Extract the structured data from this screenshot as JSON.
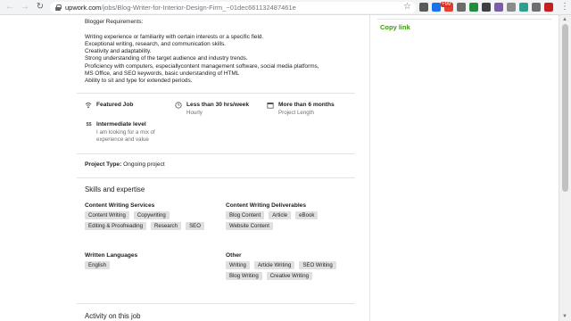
{
  "browser": {
    "back_glyph": "←",
    "forward_glyph": "→",
    "reload_glyph": "↻",
    "url_host": "upwork.com",
    "url_path": "/jobs/Blog-Writer-for-Interior-Design-Firm_~01dec661132487461e",
    "star_glyph": "☆",
    "extensions": [
      {
        "name": "extension-icon-dark",
        "color": "#5a5a5a"
      },
      {
        "name": "extension-icon-blue",
        "color": "#1a73e8"
      },
      {
        "name": "extension-icon-red",
        "color": "#e34133"
      },
      {
        "name": "extension-icon-gray",
        "color": "#6b6b6b"
      },
      {
        "name": "extension-icon-green",
        "color": "#1e8e3e"
      },
      {
        "name": "extension-icon-dark-2",
        "color": "#3c4043"
      },
      {
        "name": "extension-icon-purple",
        "color": "#7b5ea7"
      },
      {
        "name": "extension-icon-gray-2",
        "color": "#8a8a8a"
      },
      {
        "name": "extension-icon-teal",
        "color": "#2e9e8e"
      },
      {
        "name": "extension-icon-gray-3",
        "color": "#6f6f6f"
      },
      {
        "name": "extension-icon-red-2",
        "color": "#c5221f"
      }
    ],
    "badge_text": "+99",
    "menu_glyph": "⋮"
  },
  "requirements": {
    "heading": "Blogger Requirements:",
    "lines": [
      "Writing experience or familiarity with certain interests or a specific field.",
      "Exceptional writing, research, and communication skills.",
      "Creativity and adaptability.",
      "Strong understanding of the target audience and industry trends.",
      "Proficiency with computers, especiallycontent management software, social media platforms,",
      "MS Office, and SEO keywords, basic understanding of HTML",
      "Ability to sit and type for extended periods."
    ]
  },
  "features": {
    "featured": {
      "title": "Featured Job"
    },
    "hours": {
      "title": "Less than 30 hrs/week",
      "sub": "Hourly"
    },
    "length": {
      "title": "More than 6 months",
      "sub": "Project Length"
    },
    "level": {
      "badge": "$$",
      "title": "Intermediate level",
      "desc": "I am looking for a mix of experience and value"
    }
  },
  "project_type": {
    "label": "Project Type:",
    "value": "Ongoing project"
  },
  "skills": {
    "title": "Skills and expertise",
    "groups": [
      {
        "title": "Content Writing Services",
        "tags": [
          "Content Writing",
          "Copywriting",
          "Editing & Proofreading",
          "Research",
          "SEO"
        ]
      },
      {
        "title": "Content Writing Deliverables",
        "tags": [
          "Blog Content",
          "Article",
          "eBook",
          "Website Content"
        ]
      },
      {
        "title": "Written Languages",
        "tags": [
          "English"
        ]
      },
      {
        "title": "Other",
        "tags": [
          "Writing",
          "Article Writing",
          "SEO Writing",
          "Blog Writing",
          "Creative Writing"
        ]
      }
    ]
  },
  "activity": {
    "title": "Activity on this job"
  },
  "sidebar": {
    "copy_link": "Copy link"
  },
  "colors": {
    "accent_green": "#37a000",
    "tag_bg": "#e0e0e0"
  }
}
